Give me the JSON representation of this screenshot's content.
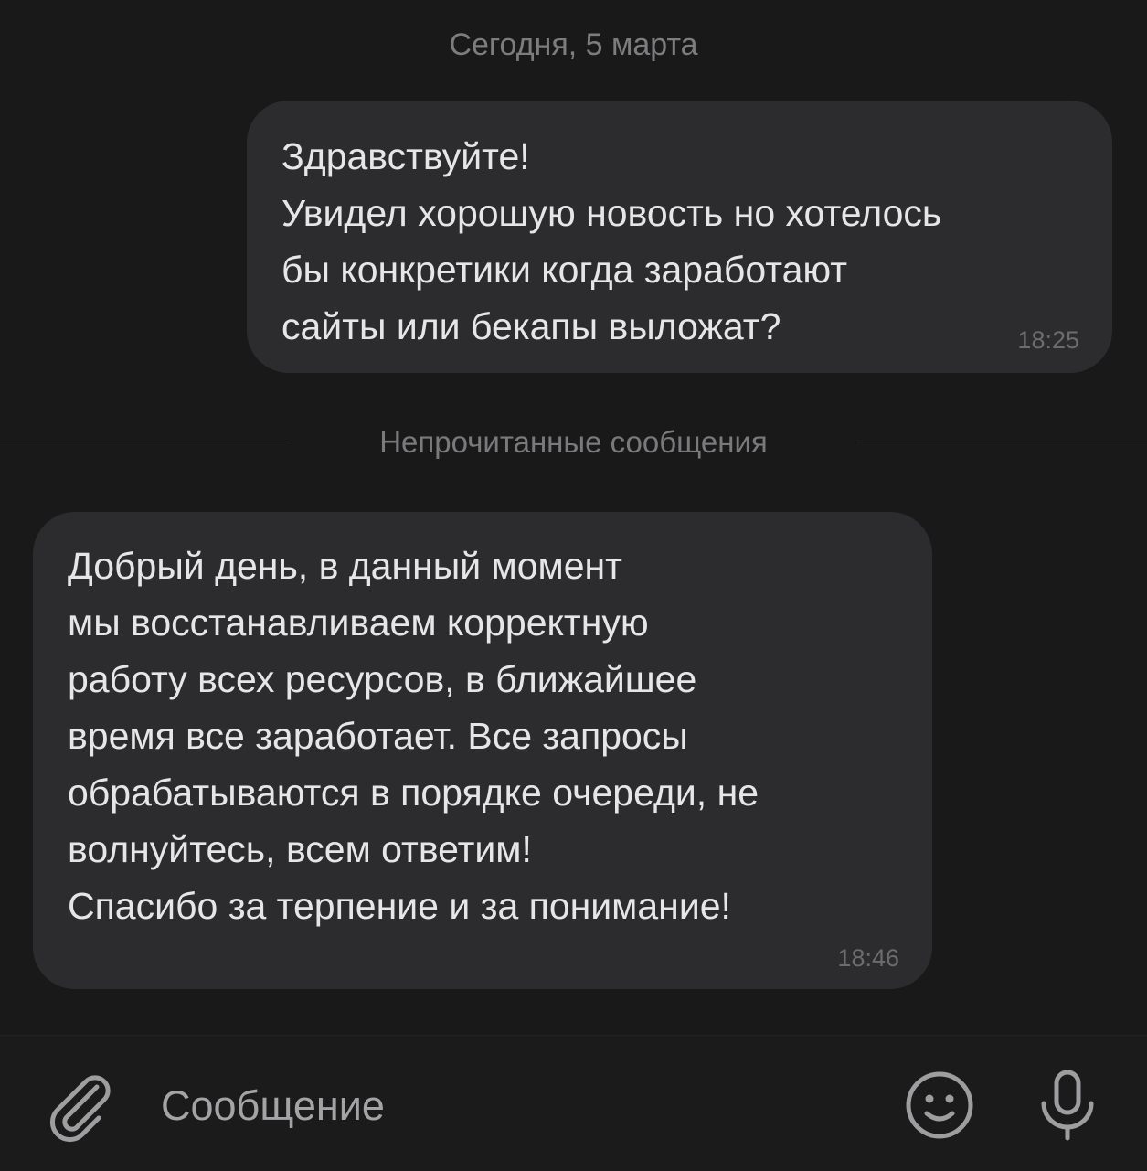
{
  "chat": {
    "date_separator": "Сегодня, 5 марта",
    "unread_separator": "Непрочитанные сообщения",
    "messages": [
      {
        "direction": "outgoing",
        "lines": [
          "Здравствуйте!",
          "Увидел хорошую новость но хотелось",
          "бы конкретики когда заработают",
          "сайты или бекапы выложат?"
        ],
        "time": "18:25"
      },
      {
        "direction": "incoming",
        "lines": [
          "Добрый день, в данный момент",
          "мы восстанавливаем корректную",
          "работу всех ресурсов, в ближайшее",
          "время все заработает. Все запросы",
          "обрабатываются в порядке очереди, не",
          "волнуйтесь, всем ответим!",
          "Спасибо за терпение и за понимание!"
        ],
        "time": "18:46"
      }
    ]
  },
  "composer": {
    "placeholder": "Сообщение",
    "value": "",
    "attach_icon": "paperclip-icon",
    "emoji_icon": "smiley-icon",
    "mic_icon": "microphone-icon"
  },
  "colors": {
    "background": "#19191a",
    "bubble": "#2c2c2e",
    "text": "#e6e6e8",
    "muted": "#7d7d7f"
  }
}
